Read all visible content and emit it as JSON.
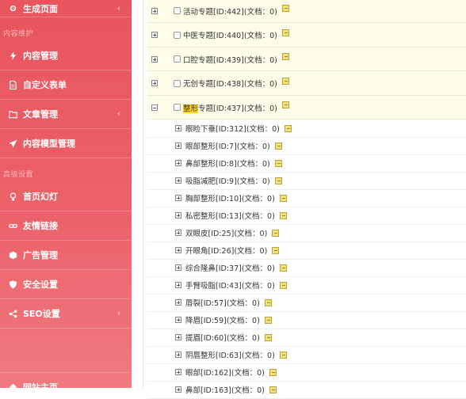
{
  "sidebar": {
    "items": [
      {
        "key": "generate",
        "label": "生成页面",
        "icon": "gear-icon",
        "chevron": "‹"
      },
      {
        "section": "内容维护"
      },
      {
        "key": "content",
        "label": "内容管理",
        "icon": "bolt-icon"
      },
      {
        "key": "form",
        "label": "自定义表单",
        "icon": "document-icon"
      },
      {
        "key": "article",
        "label": "文章管理",
        "icon": "folder-icon",
        "chevron": "‹"
      },
      {
        "key": "model",
        "label": "内容模型管理",
        "icon": "paper-plane-icon"
      },
      {
        "section": "高级设置"
      },
      {
        "key": "banner",
        "label": "首页幻灯",
        "icon": "bulb-icon"
      },
      {
        "key": "links",
        "label": "友情链接",
        "icon": "link-icon"
      },
      {
        "key": "ads",
        "label": "广告管理",
        "icon": "cube-icon"
      },
      {
        "key": "security",
        "label": "安全设置",
        "icon": "shield-icon"
      },
      {
        "key": "seo",
        "label": "SEO设置",
        "icon": "share-icon",
        "chevron": "‹"
      },
      {
        "key": "home",
        "label": "网站主页",
        "icon": "home-icon"
      }
    ]
  },
  "tree": [
    {
      "level": "top",
      "label": "活动专题[ID:442](文档：0)",
      "expanded": false
    },
    {
      "level": "top",
      "label": "中医专题[ID:440](文档：0)",
      "expanded": false
    },
    {
      "level": "top",
      "label": "口腔专题[ID:439](文档：0)",
      "expanded": false
    },
    {
      "level": "top",
      "label": "无创专题[ID:438](文档：0)",
      "expanded": false
    },
    {
      "level": "top",
      "label_prefix": "整形",
      "label": "专题[ID:437](文档：0)",
      "expanded": true
    },
    {
      "level": "sub",
      "label": "眼睑下垂[ID:312](文档：0)"
    },
    {
      "level": "sub",
      "label": "眼部整形[ID:7](文档：0)"
    },
    {
      "level": "sub",
      "label": "鼻部整形[ID:8](文档：0)"
    },
    {
      "level": "sub",
      "label": "吸脂减肥[ID:9](文档：0)"
    },
    {
      "level": "sub",
      "label": "胸部整形[ID:10](文档：0)"
    },
    {
      "level": "sub",
      "label": "私密整形[ID:13](文档：0)"
    },
    {
      "level": "sub",
      "label": "双眼皮[ID:25](文档：0)"
    },
    {
      "level": "sub",
      "label": "开眼角[ID:26](文档：0)"
    },
    {
      "level": "sub",
      "label": "综合隆鼻[ID:37](文档：0)"
    },
    {
      "level": "sub",
      "label": "手臂吸脂[ID:43](文档：0)"
    },
    {
      "level": "sub",
      "label": "唇裂[ID:57](文档：0)"
    },
    {
      "level": "sub",
      "label": "降眉[ID:59](文档：0)"
    },
    {
      "level": "sub",
      "label": "提眉[ID:60](文档：0)"
    },
    {
      "level": "sub",
      "label": "阴唇整形[ID:63](文档：0)"
    },
    {
      "level": "sub",
      "label": "眼部[ID:162](文档：0)"
    },
    {
      "level": "sub",
      "label": "鼻部[ID:163](文档：0)"
    }
  ]
}
